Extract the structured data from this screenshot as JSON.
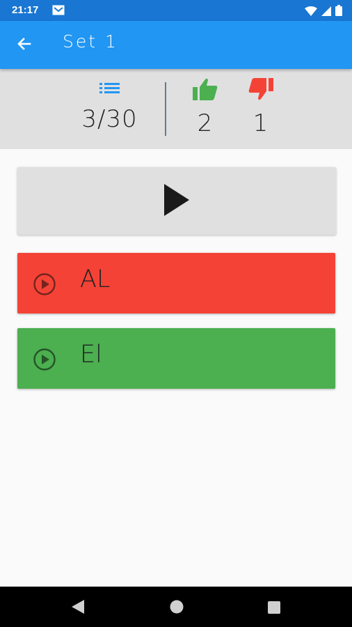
{
  "status_bar": {
    "time": "21:17",
    "icons": [
      "mail-icon",
      "wifi-icon",
      "signal-icon",
      "battery-icon"
    ]
  },
  "app_bar": {
    "title": "Set 1",
    "back_icon": "arrow-left-icon"
  },
  "stats": {
    "progress": "3/30",
    "likes": "2",
    "dislikes": "1",
    "progress_icon": "list-icon",
    "likes_icon": "thumbs-up-icon",
    "dislikes_icon": "thumbs-down-icon"
  },
  "play_button": {
    "icon": "play-icon"
  },
  "answers": [
    {
      "label": "AL",
      "icon": "play-circle-icon",
      "state": "wrong"
    },
    {
      "label": "El",
      "icon": "play-circle-icon",
      "state": "correct"
    }
  ],
  "colors": {
    "status_bar": "#1976d2",
    "app_bar": "#2196f3",
    "accent_blue": "#2196f3",
    "like_green": "#4caf50",
    "dislike_red": "#f44336",
    "stats_bg": "#e0e0e0",
    "card_gray": "#e0e0e0"
  },
  "nav_bar": {
    "icons": [
      "nav-back-icon",
      "nav-home-icon",
      "nav-recents-icon"
    ]
  }
}
